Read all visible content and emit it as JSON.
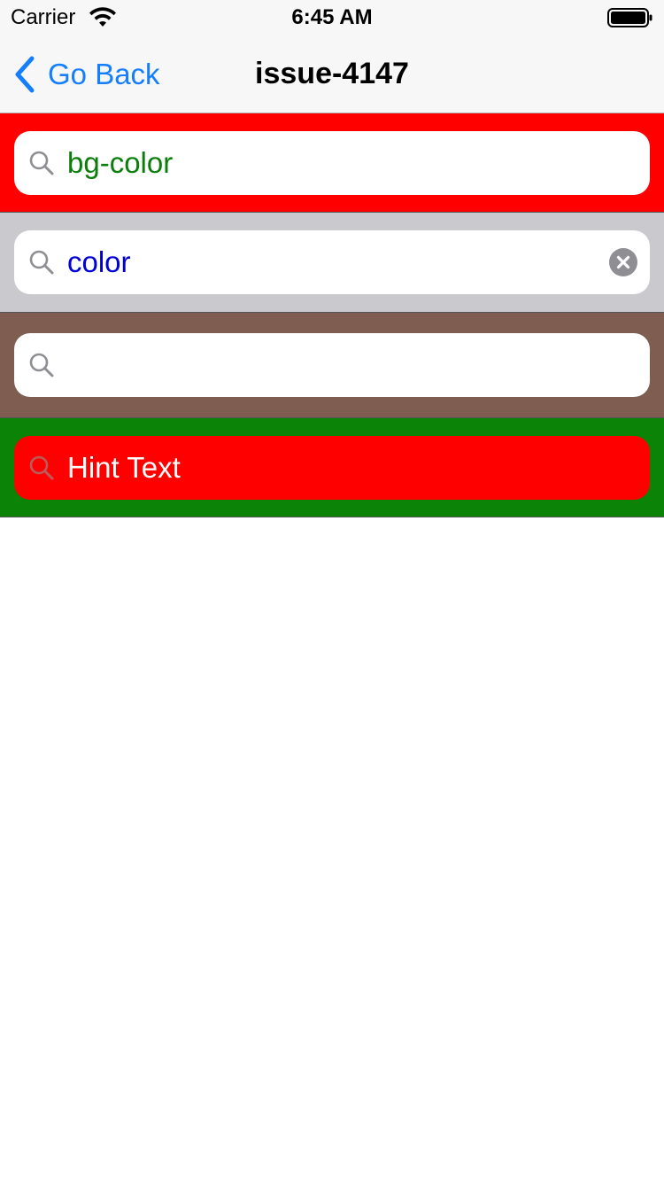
{
  "status_bar": {
    "carrier": "Carrier",
    "time": "6:45 AM",
    "wifi_icon": "wifi-icon",
    "battery_icon": "battery-icon"
  },
  "nav_bar": {
    "back_label": "Go Back",
    "back_icon": "chevron-left-icon",
    "title": "issue-4147",
    "accent_color": "#147efb"
  },
  "search_bars": [
    {
      "bar_color": "#ff0000",
      "field_color": "#ffffff",
      "text": "bg-color",
      "text_color": "#0a7d0a",
      "icon": "search-icon"
    },
    {
      "bar_color": "#c9c9ce",
      "field_color": "#ffffff",
      "text": "color",
      "text_color": "#0000d6",
      "icon": "search-icon",
      "clear_icon": "clear-icon"
    },
    {
      "bar_color": "#7f5d50",
      "field_color": "#ffffff",
      "text": "",
      "icon": "search-icon"
    },
    {
      "bar_color": "#0a8307",
      "field_color": "#ff0000",
      "placeholder": "Hint Text",
      "text_color": "#ffffff",
      "icon": "search-icon"
    }
  ]
}
